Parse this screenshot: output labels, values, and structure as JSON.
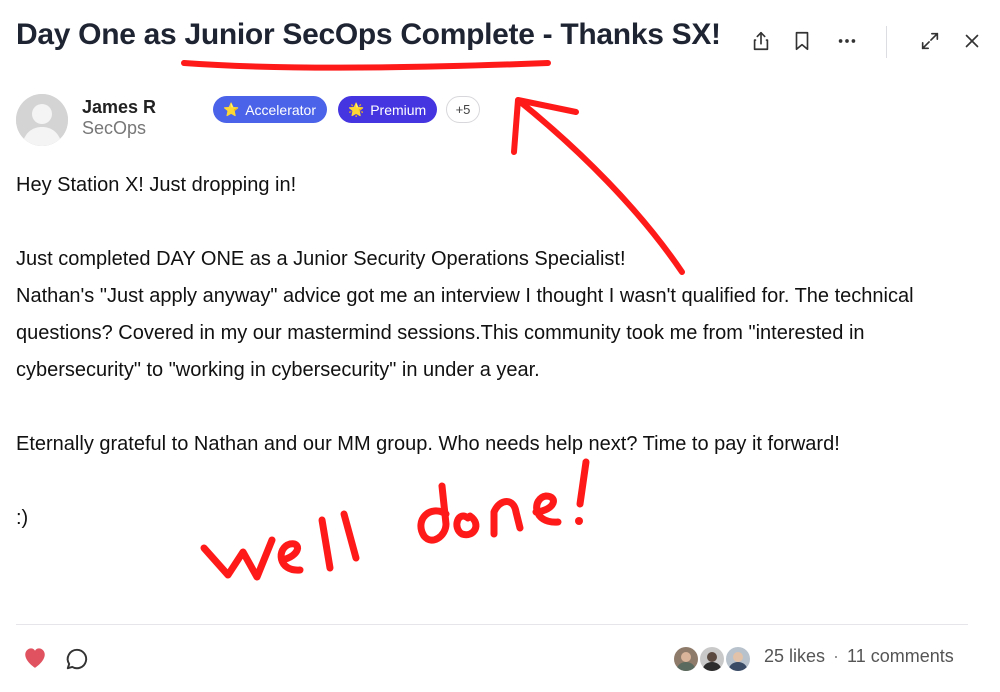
{
  "post": {
    "title": "Day One as Junior SecOps Complete - Thanks SX!",
    "author": {
      "name": "James R",
      "role": "SecOps"
    },
    "badges": [
      {
        "label": "Accelerator",
        "icon": "star-icon",
        "color": "#4b63e8"
      },
      {
        "label": "Premium",
        "icon": "sparkle-star-icon",
        "color": "#4535e0"
      }
    ],
    "badges_more": "+5",
    "body": {
      "p1": "Hey Station X! Just dropping in!",
      "p2a": "Just completed DAY ONE as a Junior Security Operations Specialist!",
      "p2b": "Nathan's \"Just apply anyway\" advice got me an interview I thought I wasn't qualified for. The technical questions? Covered in my our mastermind sessions.This community took me from \"interested in cybersecurity\" to \"working in cybersecurity\" in under a year.",
      "p3": "Eternally grateful to Nathan and our MM group. Who needs help next? Time to pay it forward!",
      "p4": ":)"
    }
  },
  "toolbar": {
    "share_icon": "share-icon",
    "bookmark_icon": "bookmark-icon",
    "more_icon": "more-dots-icon",
    "expand_icon": "expand-icon",
    "close_icon": "close-icon"
  },
  "footer": {
    "likes": "25 likes",
    "separator": "·",
    "comments": "11 comments",
    "like_color": "#e0525f"
  },
  "annotation": {
    "text": "Well done!",
    "color": "#ff1a1a"
  }
}
